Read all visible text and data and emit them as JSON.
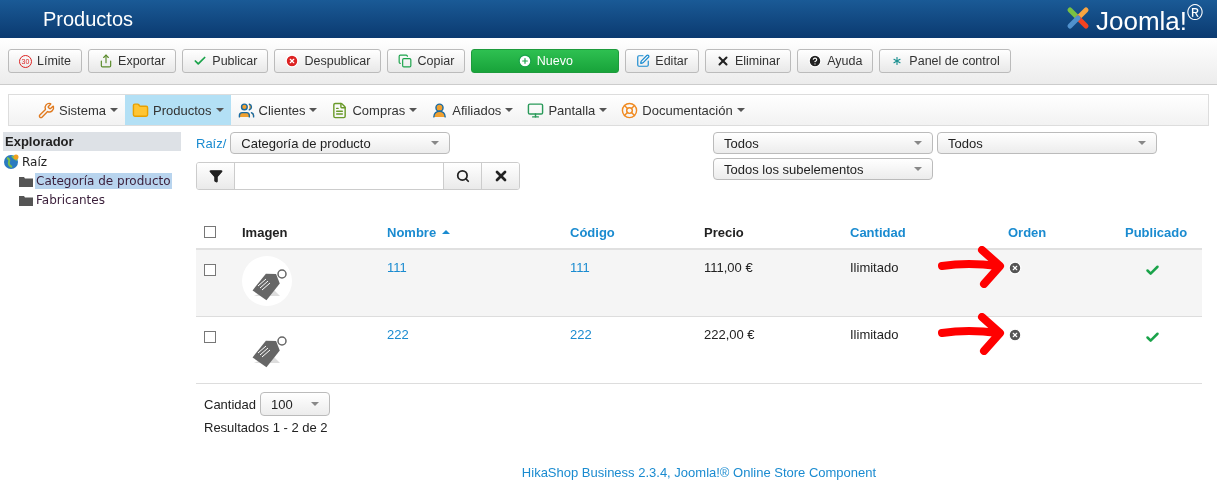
{
  "header": {
    "title": "Productos",
    "logo": "Joomla!$^{®}$"
  },
  "toolbar": [
    {
      "kind": "limit",
      "label": "Límite",
      "badge": "30"
    },
    {
      "kind": "export",
      "label": "Exportar"
    },
    {
      "kind": "publish",
      "label": "Publicar"
    },
    {
      "kind": "unpublish",
      "label": "Despublicar"
    },
    {
      "kind": "copy",
      "label": "Copiar"
    },
    {
      "kind": "new",
      "label": "Nuevo"
    },
    {
      "kind": "edit",
      "label": "Editar"
    },
    {
      "kind": "delete",
      "label": "Eliminar"
    },
    {
      "kind": "help",
      "label": "Ayuda"
    },
    {
      "kind": "panel",
      "label": "Panel de control"
    }
  ],
  "menu": [
    {
      "kind": "system",
      "label": "Sistema",
      "selected": false
    },
    {
      "kind": "products",
      "label": "Productos",
      "selected": true
    },
    {
      "kind": "customers",
      "label": "Clientes",
      "selected": false
    },
    {
      "kind": "orders",
      "label": "Compras",
      "selected": false
    },
    {
      "kind": "affiliates",
      "label": "Afiliados",
      "selected": false
    },
    {
      "kind": "display",
      "label": "Pantalla",
      "selected": false
    },
    {
      "kind": "docs",
      "label": "Documentación",
      "selected": false
    }
  ],
  "sidebar": {
    "title": "Explorador",
    "tree": [
      {
        "label": "Raíz",
        "selected": false,
        "children": [
          {
            "label": "Categoría de producto",
            "selected": true
          },
          {
            "label": "Fabricantes",
            "selected": false
          }
        ]
      }
    ]
  },
  "filters": {
    "breadcrumb": "Raíz/",
    "category": "Categoría de producto",
    "selects": [
      "Todos",
      "Todos",
      "Todos los subelementos"
    ]
  },
  "table": {
    "header_checked": false,
    "columns": [
      {
        "label": "Imagen",
        "link": false,
        "sorted": false
      },
      {
        "label": "Nombre",
        "link": true,
        "sorted": true
      },
      {
        "label": "Código",
        "link": true,
        "sorted": false
      },
      {
        "label": "Precio",
        "link": false,
        "sorted": false
      },
      {
        "label": "Cantidad",
        "link": true,
        "sorted": false
      },
      {
        "label": "Orden",
        "link": true,
        "sorted": false
      },
      {
        "label": "Publicado",
        "link": true,
        "sorted": false
      }
    ],
    "rows": [
      {
        "checked": false,
        "name": "111",
        "code": "111",
        "price": "111,00 €",
        "quantity": "Ilimitado",
        "annotated": true,
        "published": true
      },
      {
        "checked": false,
        "name": "222",
        "code": "222",
        "price": "222,00 €",
        "quantity": "Ilimitado",
        "annotated": true,
        "published": true
      }
    ]
  },
  "footer": {
    "quantity_label": "Cantidad",
    "quantity": "100",
    "results": "Resultados 1 - 2 de 2"
  },
  "credit": "HikaShop Business 2.3.4, Joomla!® Online Store Component"
}
